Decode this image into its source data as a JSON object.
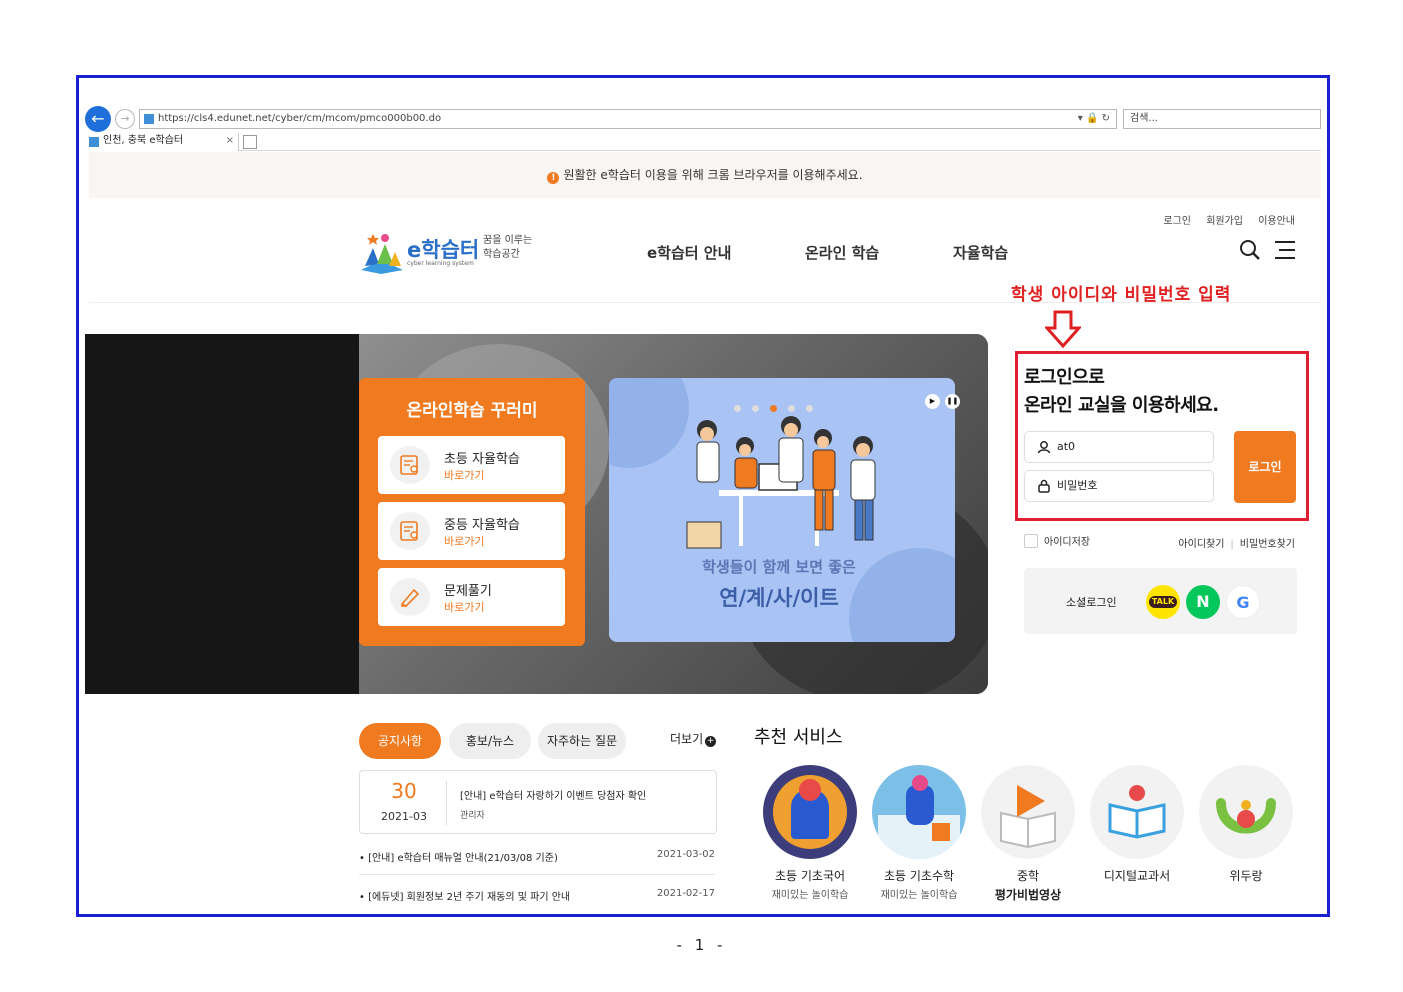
{
  "browser": {
    "url": "https://cls4.edunet.net/cyber/cm/mcom/pmco000b00.do",
    "search_placeholder": "검색...",
    "tab_title": "인천, 충북 e학습터"
  },
  "notice_banner": "원활한 e학습터 이용을 위해 크롬 브라우저를 이용해주세요.",
  "header": {
    "util_links": [
      "로그인",
      "회원가입",
      "이용안내"
    ],
    "logo_text": "e학습터",
    "logo_sub": "cyber learning system",
    "logo_slogan_1": "꿈을 이루는",
    "logo_slogan_2": "학습공간",
    "nav": [
      "e학습터 안내",
      "온라인 학습",
      "자율학습"
    ]
  },
  "annotation": {
    "text": "학생 아이디와 비밀번호 입력",
    "color": "#e02020"
  },
  "hero": {
    "panel_title": "온라인학습 꾸러미",
    "buttons": [
      {
        "title": "초등 자율학습",
        "sub": "바로가기",
        "icon": "list-search-icon"
      },
      {
        "title": "중등 자율학습",
        "sub": "바로가기",
        "icon": "list-search-icon"
      },
      {
        "title": "문제풀기",
        "sub": "바로가기",
        "icon": "pencil-hand-icon"
      }
    ],
    "card_caption_1": "학생들이 함께 보면 좋은",
    "card_caption_2": "연/계/사/이트",
    "slides_total": 5,
    "active_slide": 3
  },
  "login": {
    "title_line1": "로그인으로",
    "title_line2": "온라인 교실을 이용하세요.",
    "id_value": "at0",
    "pw_placeholder": "비밀번호",
    "button": "로그인",
    "save_id": "아이디저장",
    "find_id": "아이디찾기",
    "find_pw": "비밀번호찾기",
    "social_label": "소셜로그인",
    "social": [
      "TALK",
      "N",
      "G"
    ]
  },
  "board": {
    "tabs": [
      "공지사항",
      "홍보/뉴스",
      "자주하는 질문"
    ],
    "more": "더보기",
    "featured": {
      "day": "30",
      "ym": "2021-03",
      "title": "[안내] e학습터 자랑하기 이벤트 당첨자 확인",
      "author": "관리자"
    },
    "rows": [
      {
        "title": "[안내] e학습터 매뉴얼 안내(21/03/08 기준)",
        "date": "2021-03-02"
      },
      {
        "title": "[에듀넷] 회원정보 2년 주기 재동의 및 파기 안내",
        "date": "2021-02-17"
      }
    ]
  },
  "recommended": {
    "title": "추천 서비스",
    "items": [
      {
        "name": "초등 기초국어",
        "sub": "재미있는 놀이학습"
      },
      {
        "name": "초등 기초수학",
        "sub": "재미있는 놀이학습"
      },
      {
        "name": "중학",
        "sub": "평가비법영상"
      },
      {
        "name": "디지털교과서",
        "sub": ""
      },
      {
        "name": "위두랑",
        "sub": ""
      }
    ]
  },
  "colors": {
    "accent": "#f07a20",
    "frame": "#1a1fd0",
    "annotation": "#e02030"
  },
  "page_number": "- 1 -"
}
